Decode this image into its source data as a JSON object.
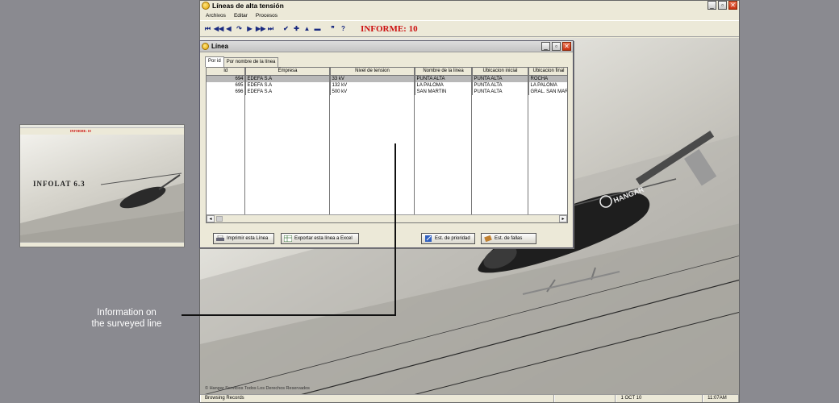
{
  "app": {
    "title": "Líneas de alta tensión",
    "menu": [
      "Archivos",
      "Editar",
      "Procesos"
    ],
    "toolbar_icons": [
      "first-icon",
      "rewind-icon",
      "previous-icon",
      "refresh-icon",
      "next-icon",
      "fast-forward-icon",
      "last-icon",
      "check-icon",
      "add-icon",
      "up-icon",
      "remove-icon",
      "quote-icon",
      "help-icon"
    ],
    "informe": "INFORME: 10",
    "copyright": "© Hangar Servicios Todos Los Derechos Reservados",
    "status": {
      "mode": "Browsing Records",
      "date": "1 OCT 10",
      "time": "11:07AM"
    }
  },
  "thumbnail": {
    "logo": "INFOLAT 6.3",
    "informe": "INFORME: 10"
  },
  "linea_window": {
    "title": "Línea",
    "tabs": [
      "Por id",
      "Por nombre de la línea"
    ],
    "columns": [
      "Id",
      "Empresa",
      "Nivel de tension",
      "Nombre de la linea",
      "Ubicacion inicial",
      "Ubicacion final"
    ],
    "rows": [
      [
        "694",
        "EDEFA S.A",
        "33 kV",
        "PUNTA ALTA",
        "PUNTA ALTA",
        "ROCHA"
      ],
      [
        "695",
        "EDEFA S.A",
        "132 kV",
        "LA PALOMA",
        "PUNTA ALTA",
        "LA PALOMA"
      ],
      [
        "696",
        "EDEFA S.A",
        "500 kV",
        "SAN MARTIN",
        "PUNTA ALTA",
        "GRAL. SAN MAR"
      ]
    ],
    "selected_row": 0,
    "buttons": {
      "print": "Imprimir esta Línea",
      "export": "Exportar esta línea a  Excel",
      "priority": "Est. de prioridad",
      "faults": "Est. de fallas"
    }
  },
  "annotation": {
    "line1": "Information on",
    "line2": "the surveyed line"
  },
  "colors": {
    "informe_red": "#cc1010",
    "selected_row": "#b8b8b8",
    "page_bg": "#8a8a90"
  }
}
